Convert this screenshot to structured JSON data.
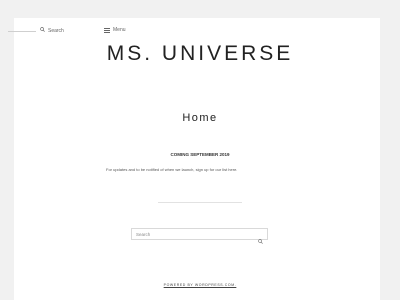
{
  "header": {
    "search_label": "Search",
    "menu_label": "Menu"
  },
  "site_title": "MS. UNIVERSE",
  "page_title": "Home",
  "content": {
    "announcement": "COMING SEPTEMBER 2019",
    "intro": "For updates and to be notified of when we launch, sign up for our list here."
  },
  "search": {
    "placeholder": "Search",
    "value": ""
  },
  "footer": {
    "credit": "POWERED BY WORDPRESS.COM."
  },
  "icons": {
    "header_search": "search-icon",
    "menu": "hamburger-menu-icon",
    "form_search": "search-icon"
  }
}
